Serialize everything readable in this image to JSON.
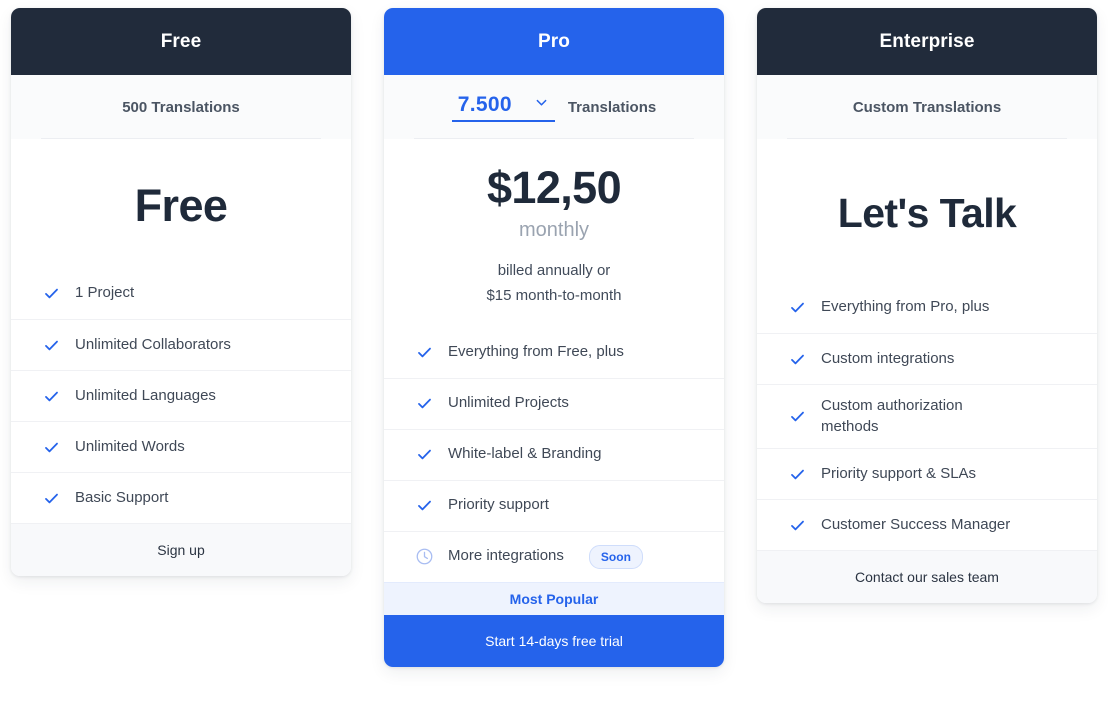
{
  "plans": [
    {
      "name": "Free",
      "header_style": "dark",
      "quota_type": "text",
      "quota_text": "500 Translations",
      "price": "Free",
      "period": "",
      "note": "",
      "features": [
        {
          "icon": "check-icon",
          "label": "1 Project",
          "badge": ""
        },
        {
          "icon": "check-icon",
          "label": "Unlimited Collaborators",
          "badge": ""
        },
        {
          "icon": "check-icon",
          "label": "Unlimited Languages",
          "badge": ""
        },
        {
          "icon": "check-icon",
          "label": "Unlimited Words",
          "badge": ""
        },
        {
          "icon": "check-icon",
          "label": "Basic Support",
          "badge": ""
        }
      ],
      "footer_link": "Sign up",
      "popular_label": "",
      "cta_label": ""
    },
    {
      "name": "Pro",
      "header_style": "blue",
      "quota_type": "select",
      "quota_value": "7.500",
      "quota_label": "Translations",
      "price": "$12,50",
      "period": "monthly",
      "note": "billed annually or\n$15 month-to-month",
      "note_line1": "billed annually or",
      "note_line2": "$15 month-to-month",
      "features": [
        {
          "icon": "check-icon",
          "label": "Everything from Free, plus",
          "badge": ""
        },
        {
          "icon": "check-icon",
          "label": "Unlimited Projects",
          "badge": ""
        },
        {
          "icon": "check-icon",
          "label": "White-label & Branding",
          "badge": ""
        },
        {
          "icon": "check-icon",
          "label": "Priority support",
          "badge": ""
        },
        {
          "icon": "clock-icon",
          "label": "More integrations",
          "badge": "Soon"
        }
      ],
      "footer_link": "",
      "popular_label": "Most Popular",
      "cta_label": "Start 14-days free trial"
    },
    {
      "name": "Enterprise",
      "header_style": "dark",
      "quota_type": "text",
      "quota_text": "Custom Translations",
      "price": "Let's Talk",
      "period": "",
      "note": "",
      "features": [
        {
          "icon": "check-icon",
          "label": "Everything from Pro, plus",
          "badge": ""
        },
        {
          "icon": "check-icon",
          "label": "Custom integrations",
          "badge": ""
        },
        {
          "icon": "check-icon",
          "label": "Custom authorization methods",
          "badge": ""
        },
        {
          "icon": "check-icon",
          "label": "Priority support & SLAs",
          "badge": ""
        },
        {
          "icon": "check-icon",
          "label": "Customer Success Manager",
          "badge": ""
        }
      ],
      "footer_link": "Contact our sales team",
      "popular_label": "",
      "cta_label": ""
    }
  ],
  "colors": {
    "accent_blue": "#2563eb",
    "header_dark": "#212b3b",
    "badge_bg": "#eef3fe",
    "text_dark": "#1f2a3a",
    "text_muted": "#9aa3b0"
  }
}
